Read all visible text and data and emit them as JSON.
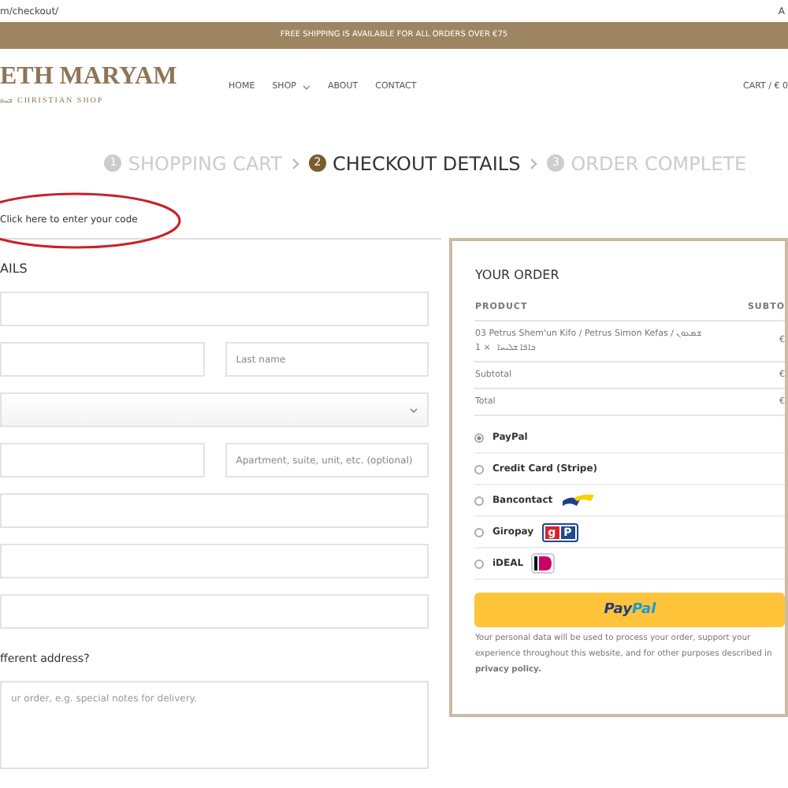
{
  "address_bar": {
    "url": "m/checkout/",
    "corner": "A"
  },
  "banner": "FREE SHIPPING IS AVAILABLE FOR ALL ORDERS OVER €75",
  "logo": {
    "title": "ETH MARYAM",
    "script": "ܒܝܬ",
    "tagline": "CHRISTIAN SHOP"
  },
  "nav": [
    {
      "label": "HOME",
      "dropdown": false
    },
    {
      "label": "SHOP",
      "dropdown": true
    },
    {
      "label": "ABOUT",
      "dropdown": false
    },
    {
      "label": "CONTACT",
      "dropdown": false
    }
  ],
  "cart": "CART / € 0",
  "steps": [
    {
      "number": "1",
      "label": "SHOPPING CART",
      "selected": false
    },
    {
      "number": "2",
      "label": "CHECKOUT DETAILS",
      "selected": true
    },
    {
      "number": "3",
      "label": "ORDER COMPLETE",
      "selected": false
    }
  ],
  "coupon": {
    "link": "Click here to enter your code"
  },
  "billing": {
    "heading": "AILS",
    "rows": [
      [
        {
          "kind": "input"
        }
      ],
      [
        {
          "kind": "input"
        },
        {
          "kind": "input",
          "placeholder": "Last name"
        }
      ],
      [
        {
          "kind": "select"
        }
      ],
      [
        {
          "kind": "input"
        },
        {
          "kind": "input",
          "placeholder": "Apartment, suite, unit, etc. (optional)"
        }
      ],
      [
        {
          "kind": "input"
        }
      ],
      [
        {
          "kind": "input"
        }
      ],
      [
        {
          "kind": "input"
        }
      ]
    ]
  },
  "shipping_question": "fferent address?",
  "notes": {
    "placeholder": "ur order, e.g. special notes for delivery."
  },
  "order": {
    "heading": "YOUR ORDER",
    "columns": [
      "PRODUCT",
      "SUBTO"
    ],
    "items": [
      {
        "name": "03 Petrus Shem'un Kifo / Petrus Simon Kefas / ܫܡܥܘܢ",
        "qty": "1 ×",
        "name_2": "ܟܐܦܐ ܫܠܝܚܐ",
        "price": "€"
      }
    ],
    "totals": [
      {
        "label": "Subtotal",
        "value": "€"
      },
      {
        "label": "Total",
        "value": "€"
      }
    ]
  },
  "payments": [
    {
      "label": "PayPal",
      "selected": true,
      "kind": "plain"
    },
    {
      "label": "Credit Card (Stripe)",
      "selected": false,
      "kind": "plain"
    },
    {
      "label": "Bancontact",
      "selected": false,
      "kind": "bancontact"
    },
    {
      "label": "Giropay",
      "selected": false,
      "kind": "giropay",
      "logo_text": [
        "g",
        "P"
      ]
    },
    {
      "label": "iDEAL",
      "selected": false,
      "kind": "ideal"
    }
  ],
  "pay_button": {
    "part_1": "Pay",
    "part_2": "Pal"
  },
  "privacy": {
    "text": "Your personal data will be used to process your order, support your experience throughout this website, and for other purposes described in",
    "link": "privacy policy."
  }
}
